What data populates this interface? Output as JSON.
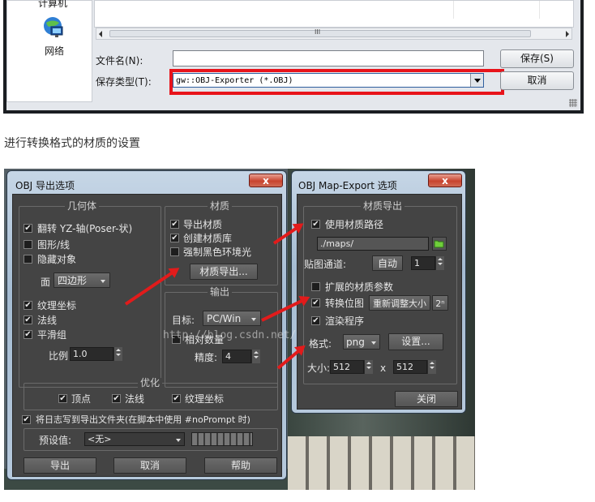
{
  "save_dialog": {
    "places": [
      {
        "label": "计算机",
        "icon": "computer-icon"
      },
      {
        "label": "网络",
        "icon": "network-icon"
      }
    ],
    "scrollbar_grip": "III",
    "filename_label": "文件名(N):",
    "filename_value": "",
    "filetype_label": "保存类型(T):",
    "filetype_value": "gw::OBJ-Exporter (*.OBJ)",
    "save_button": "保存(S)",
    "cancel_button": "取消",
    "highlight_color": "#e8141b"
  },
  "caption": "进行转换格式的材质的设置",
  "obj_export": {
    "title": "OBJ 导出选项",
    "close": "x",
    "geometry": {
      "title": "几何体",
      "flip_yz": {
        "label": "翻转 YZ-轴(Poser-状)",
        "checked": true
      },
      "shapes_lines": {
        "label": "图形/线",
        "checked": false
      },
      "hidden_objects": {
        "label": "隐藏对象",
        "checked": false
      },
      "faces_label": "面",
      "faces_value": "四边形",
      "texture_coords": {
        "label": "纹理坐标",
        "checked": true
      },
      "normals": {
        "label": "法线",
        "checked": true
      },
      "smoothing_groups": {
        "label": "平滑组",
        "checked": true
      },
      "scale_label": "比例",
      "scale_value": "1.0"
    },
    "material": {
      "title": "材质",
      "export_materials": {
        "label": "导出材质",
        "checked": true
      },
      "create_mat_lib": {
        "label": "创建材质库",
        "checked": true
      },
      "force_black_ambient": {
        "label": "强制黑色环境光",
        "checked": false
      },
      "material_export_button": "材质导出..."
    },
    "output": {
      "title": "输出",
      "target_label": "目标:",
      "target_value": "PC/Win",
      "relative_numbers": {
        "label": "相对数量",
        "checked": false
      },
      "precision_label": "精度:",
      "precision_value": "4"
    },
    "optimize": {
      "title": "优化",
      "vertices": {
        "label": "顶点",
        "checked": true
      },
      "normals": {
        "label": "法线",
        "checked": true
      },
      "texcoords": {
        "label": "纹理坐标",
        "checked": true
      }
    },
    "log": {
      "label": "将日志写到导出文件夹(在脚本中使用 #noPrompt 时)",
      "checked": true
    },
    "preset_label": "预设值:",
    "preset_value": "<无>",
    "buttons": {
      "export": "导出",
      "cancel": "取消",
      "help": "帮助"
    }
  },
  "map_export": {
    "title": "OBJ Map-Export 选项",
    "close": "x",
    "group_title": "材质导出",
    "use_material_path": {
      "label": "使用材质路径",
      "checked": true
    },
    "path_value": "./maps/",
    "map_channel_label": "贴图通道:",
    "auto_button": "自动",
    "channel_value": "1",
    "extended_params": {
      "label": "扩展的材质参数",
      "checked": false
    },
    "convert_bitmaps": {
      "label": "转换位图",
      "checked": true
    },
    "resize_button": "重新调整大小",
    "pow2_button": "2ⁿ",
    "render_procedurals": {
      "label": "渲染程序",
      "checked": true
    },
    "format_label": "格式:",
    "format_value": "png",
    "settings_button": "设置...",
    "size_label": "大小:",
    "width_value": "512",
    "x_label": "x",
    "height_value": "512",
    "close_button": "关闭"
  },
  "watermark": "http://blog.csdn.net/"
}
